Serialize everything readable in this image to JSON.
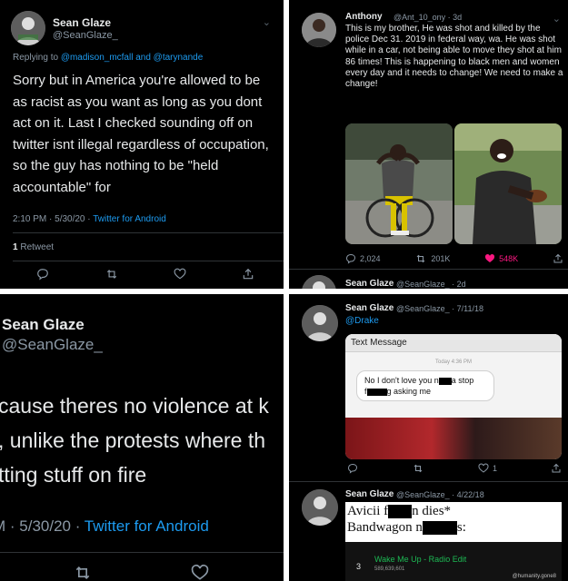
{
  "panel1": {
    "name": "Sean Glaze",
    "handle": "@SeanGlaze_",
    "replying_prefix": "Replying to ",
    "replying_to": "@madison_mcfall and @tarynande",
    "text": "Sorry but in America you're allowed to be as racist as you want as long as you dont act on it. Last I checked sounding off on twitter isnt illegal regardless of occupation, so the guy has nothing to be \"held accountable\" for",
    "timestamp": "2:10 PM · 5/30/20 · ",
    "source": "Twitter for Android",
    "retweets_count": "1",
    "retweets_label": "Retweet"
  },
  "panel2": {
    "name": "Anthony",
    "handle": "@Ant_10_ony · 3d",
    "text": "This is my brother, He was shot and killed by the police Dec 31. 2019 in federal way, wa. He was shot while in a car, not being able to move they shot at him 86 times! This is happening to black men and women every day and it needs to change! We need to make a change!",
    "replies": "2,024",
    "retweets": "201K",
    "likes": "548K",
    "reply2_name": "Sean Glaze",
    "reply2_handle": "@SeanGlaze_ · 2d"
  },
  "panel3": {
    "name": "Sean Glaze",
    "handle": "@SeanGlaze_",
    "lines": [
      "cause theres no violence at k",
      ", unlike the protests where th",
      "tting stuff on fire"
    ],
    "timestamp": "M · 5/30/20 · ",
    "source": "Twitter for Android"
  },
  "panel4": {
    "tweet1": {
      "name": "Sean Glaze",
      "handle": "@SeanGlaze_ · 7/11/18",
      "mention": "@Drake",
      "sms_header": "Text Message",
      "sms_time": "Today 4:36 PM",
      "sms_line1a": "No I don't love you n",
      "sms_line1b": "a stop",
      "sms_line2a": "f",
      "sms_line2b": "g asking me",
      "likes": "1"
    },
    "tweet2": {
      "name": "Sean Glaze",
      "handle": "@SeanGlaze_ · 4/22/18",
      "meme_line1a": "Avicii f",
      "meme_line1b": "n dies*",
      "meme_line2a": "Bandwagon n",
      "meme_line2b": "s:",
      "track_number": "3",
      "track_title": "Wake Me Up - Radio Edit",
      "track_plays": "589,639,601",
      "watermark": "@humanity.gone8"
    }
  },
  "colors": {
    "background": "#000000",
    "text": "#e7e9ea",
    "muted": "#8b98a5",
    "link": "#1d9bf0",
    "like": "#f91880",
    "spotify": "#1db954"
  }
}
